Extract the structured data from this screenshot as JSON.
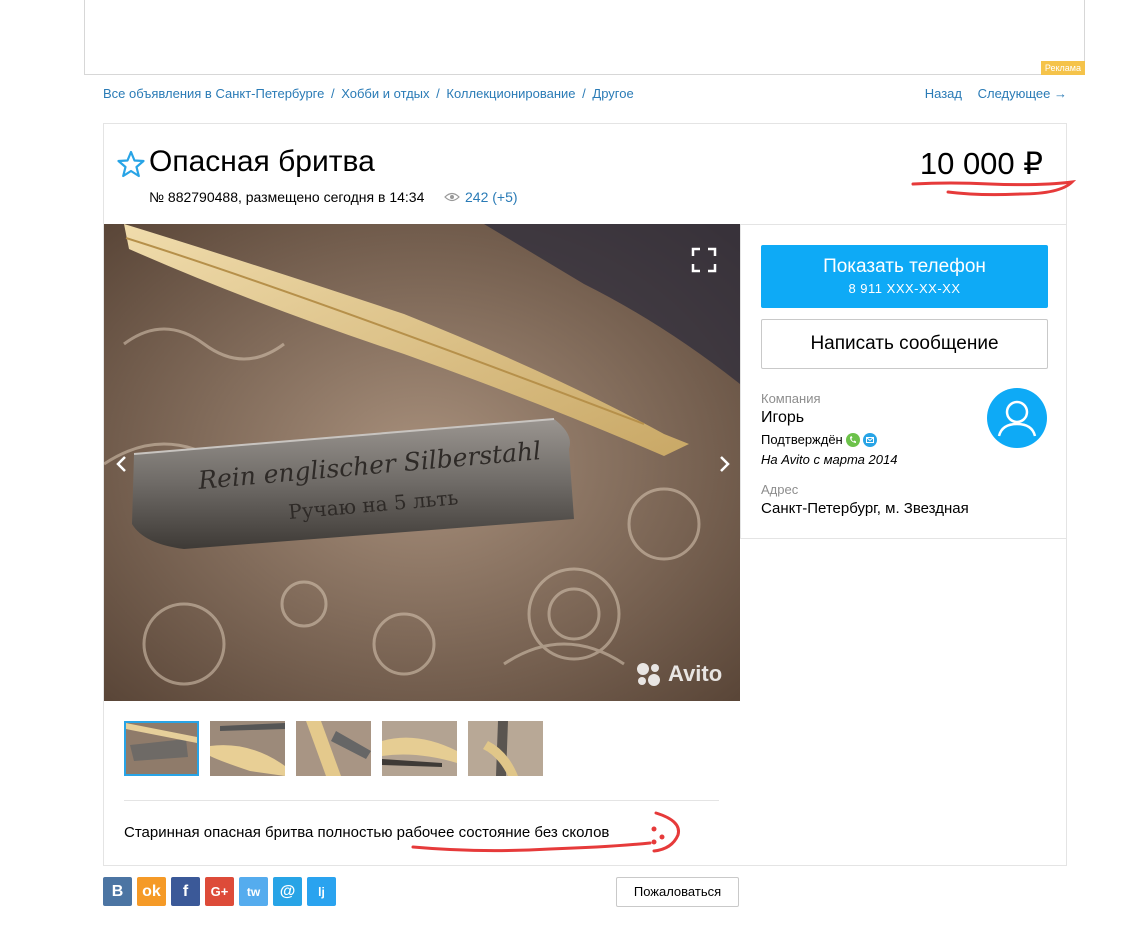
{
  "ad": {
    "label": "Реклама"
  },
  "breadcrumb": {
    "items": [
      "Все объявления в Санкт-Петербурге",
      "Хобби и отдых",
      "Коллекционирование",
      "Другое"
    ],
    "separator": "/"
  },
  "nav": {
    "back": "Назад",
    "next": "Следующее →"
  },
  "listing": {
    "title": "Опасная бритва",
    "meta": "№ 882790488, размещено сегодня в 14:34",
    "views": "242 (+5)",
    "price": "10 000 ₽",
    "watermark": "Avito",
    "blade_text_line1": "Rein englischer Silberstahl",
    "blade_text_line2": "Ручаю на 5 льть",
    "description": "Старинная опасная бритва полностью рабочее состояние без сколов"
  },
  "seller": {
    "show_phone": "Показать телефон",
    "phone_masked": "8 911 XXX-XX-XX",
    "write_message": "Написать сообщение",
    "company_label": "Компания",
    "name": "Игорь",
    "verified": "Подтверждён",
    "since": "На Avito с марта 2014",
    "address_label": "Адрес",
    "address": "Санкт-Петербург, м. Звездная"
  },
  "share": {
    "items": [
      "В",
      "ok",
      "f",
      "G+",
      "tw",
      "@",
      "lj"
    ]
  },
  "report": "Пожаловаться",
  "colors": {
    "accent": "#0eaaf6",
    "link": "#2a7bb6",
    "annotation": "#e63a3a"
  }
}
